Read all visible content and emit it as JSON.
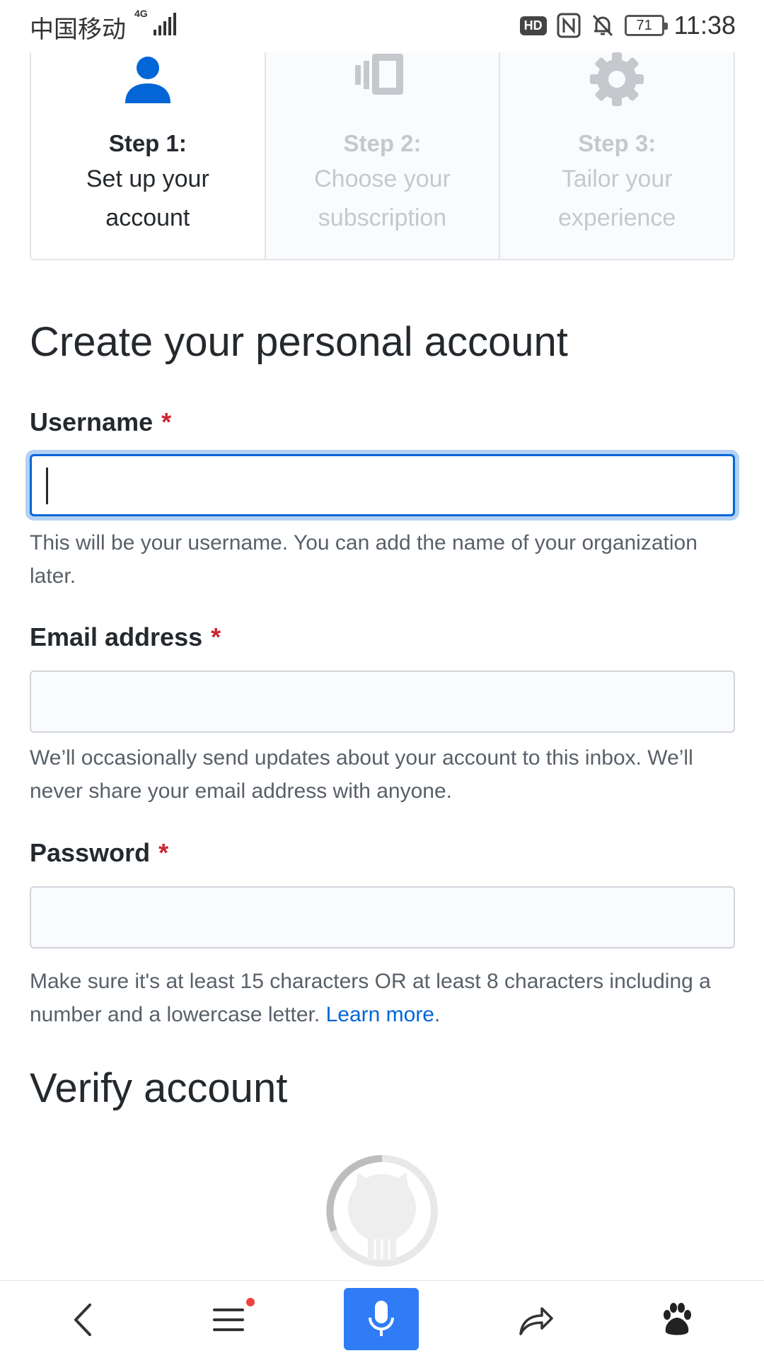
{
  "status_bar": {
    "carrier": "中国移动",
    "network": "4G",
    "hd": "HD",
    "battery": "71",
    "time": "11:38"
  },
  "steps": [
    {
      "title": "Step 1:",
      "desc": "Set up your account",
      "icon": "person-icon",
      "active": true
    },
    {
      "title": "Step 2:",
      "desc": "Choose your subscription",
      "icon": "subscription-icon",
      "active": false
    },
    {
      "title": "Step 3:",
      "desc": "Tailor your experience",
      "icon": "gear-icon",
      "active": false
    }
  ],
  "form": {
    "heading": "Create your personal account",
    "username": {
      "label": "Username",
      "required_mark": "*",
      "value": "",
      "note": "This will be your username. You can add the name of your organization later."
    },
    "email": {
      "label": "Email address",
      "required_mark": "*",
      "value": "",
      "note": "We’ll occasionally send updates about your account to this inbox. We’ll never share your email address with anyone."
    },
    "password": {
      "label": "Password",
      "required_mark": "*",
      "value": "",
      "note": "Make sure it's at least 15 characters OR at least 8 characters including a number and a lowercase letter.",
      "link": "Learn more",
      "period": "."
    }
  },
  "verify": {
    "heading": "Verify account",
    "icon": "octocat-loading-icon"
  },
  "bottom_nav": {
    "items": [
      "back-icon",
      "menu-icon",
      "microphone-icon",
      "share-icon",
      "baidu-icon"
    ],
    "accent": "#2f7cf6"
  }
}
